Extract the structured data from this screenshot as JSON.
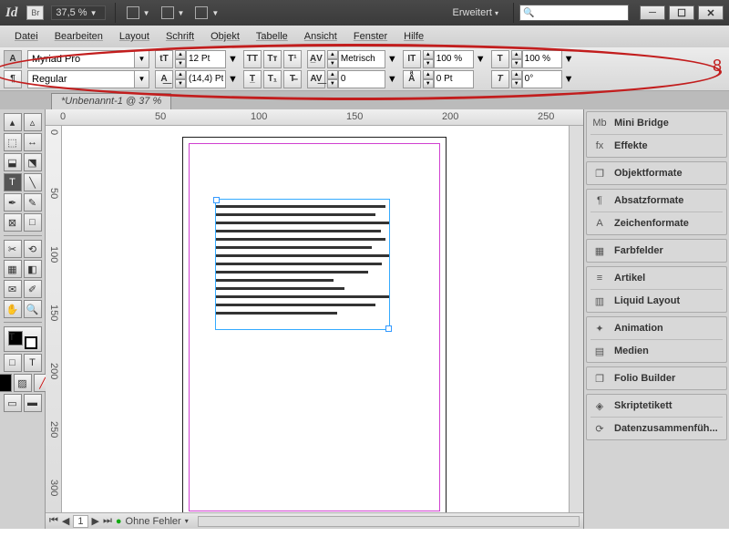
{
  "titlebar": {
    "app": "Id",
    "br": "Br",
    "zoom": "37,5 %",
    "workspace": "Erweitert"
  },
  "menu": [
    "Datei",
    "Bearbeiten",
    "Layout",
    "Schrift",
    "Objekt",
    "Tabelle",
    "Ansicht",
    "Fenster",
    "Hilfe"
  ],
  "control": {
    "font": "Myriad Pro",
    "style": "Regular",
    "size": "12 Pt",
    "leading": "(14,4) Pt",
    "kerning": "Metrisch",
    "tracking": "0",
    "vscale": "100 %",
    "bshift": "0 Pt",
    "hscale": "100 %",
    "skew": "0°"
  },
  "annotation": "8",
  "doc_tab": "*Unbenannt-1 @ 37 %",
  "hruler": [
    "0",
    "50",
    "100",
    "150",
    "200",
    "250"
  ],
  "vruler": [
    "0",
    "50",
    "100",
    "150",
    "200",
    "250",
    "300"
  ],
  "status": {
    "page": "1",
    "errors": "Ohne Fehler"
  },
  "panels": [
    {
      "items": [
        [
          "Mb",
          "Mini Bridge"
        ],
        [
          "fx",
          "Effekte"
        ]
      ]
    },
    {
      "items": [
        [
          "❐",
          "Objektformate"
        ]
      ]
    },
    {
      "items": [
        [
          "¶",
          "Absatzformate"
        ],
        [
          "A",
          "Zeichenformate"
        ]
      ]
    },
    {
      "items": [
        [
          "▦",
          "Farbfelder"
        ]
      ]
    },
    {
      "items": [
        [
          "≡",
          "Artikel"
        ],
        [
          "▥",
          "Liquid Layout"
        ]
      ]
    },
    {
      "items": [
        [
          "✦",
          "Animation"
        ],
        [
          "▤",
          "Medien"
        ]
      ]
    },
    {
      "items": [
        [
          "❐",
          "Folio Builder"
        ]
      ]
    },
    {
      "items": [
        [
          "◈",
          "Skriptetikett"
        ],
        [
          "⟳",
          "Datenzusammenfüh..."
        ]
      ]
    }
  ]
}
